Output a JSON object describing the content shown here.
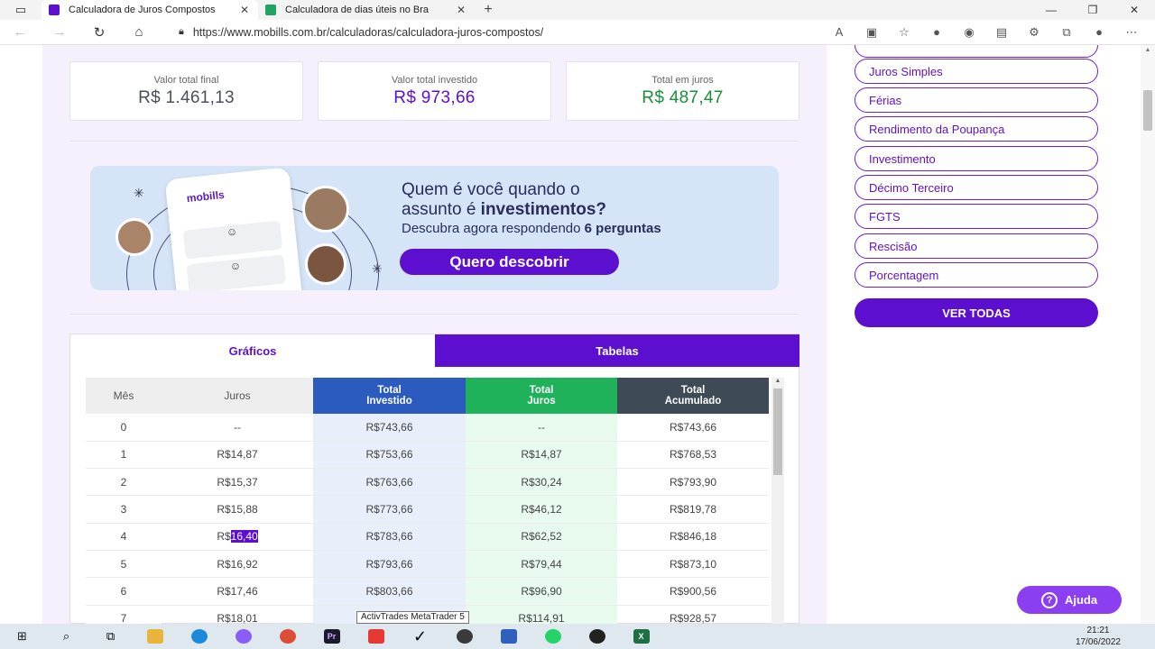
{
  "browser": {
    "tabs": [
      {
        "title": "Calculadora de Juros Compostos",
        "favicon_color": "#5d0fcf",
        "active": true
      },
      {
        "title": "Calculadora de dias úteis no Bra",
        "favicon_color": "#1fa463",
        "active": false
      }
    ],
    "url": "https://www.mobills.com.br/calculadoras/calculadora-juros-compostos/"
  },
  "summary": [
    {
      "label": "Valor total final",
      "value": "R$ 1.461,13",
      "color": "#4a4f5a"
    },
    {
      "label": "Valor total investido",
      "value": "R$ 973,66",
      "color": "#5d0fcf"
    },
    {
      "label": "Total em juros",
      "value": "R$ 487,47",
      "color": "#1a8f3a"
    }
  ],
  "banner": {
    "brand": "mobills",
    "headline_1": "Quem é você quando o",
    "headline_2a": "assunto é ",
    "headline_2b": "investimentos?",
    "sub_a": "Descubra agora respondendo ",
    "sub_b": "6 perguntas",
    "cta": "Quero descobrir"
  },
  "result_tabs": {
    "graphs": "Gráficos",
    "tables": "Tabelas"
  },
  "table": {
    "headers": {
      "mes": "Mês",
      "juros": "Juros",
      "invested_1": "Total",
      "invested_2": "Investido",
      "interest_1": "Total",
      "interest_2": "Juros",
      "accum_1": "Total",
      "accum_2": "Acumulado"
    },
    "rows": [
      {
        "mes": "0",
        "juros": "--",
        "investido": "R$743,66",
        "total_juros": "--",
        "acumulado": "R$743,66"
      },
      {
        "mes": "1",
        "juros": "R$14,87",
        "investido": "R$753,66",
        "total_juros": "R$14,87",
        "acumulado": "R$768,53"
      },
      {
        "mes": "2",
        "juros": "R$15,37",
        "investido": "R$763,66",
        "total_juros": "R$30,24",
        "acumulado": "R$793,90"
      },
      {
        "mes": "3",
        "juros": "R$15,88",
        "investido": "R$773,66",
        "total_juros": "R$46,12",
        "acumulado": "R$819,78"
      },
      {
        "mes": "4",
        "juros_prefix": "R$",
        "juros_selected": "16,40",
        "investido": "R$783,66",
        "total_juros": "R$62,52",
        "acumulado": "R$846,18"
      },
      {
        "mes": "5",
        "juros": "R$16,92",
        "investido": "R$793,66",
        "total_juros": "R$79,44",
        "acumulado": "R$873,10"
      },
      {
        "mes": "6",
        "juros": "R$17,46",
        "investido": "R$803,66",
        "total_juros": "R$96,90",
        "acumulado": "R$900,56"
      },
      {
        "mes": "7",
        "juros": "R$18,01",
        "investido": "",
        "total_juros": "R$114,91",
        "acumulado": "R$928,57"
      }
    ]
  },
  "sidebar": {
    "links": [
      "Juros Simples",
      "Férias",
      "Rendimento da Poupança",
      "Investimento",
      "Décimo Terceiro",
      "FGTS",
      "Rescisão",
      "Porcentagem"
    ],
    "see_all": "VER TODAS"
  },
  "help": "Ajuda",
  "tooltip": "ActivTrades MetaTrader 5",
  "clock": {
    "time": "21:21",
    "date": "17/06/2022"
  }
}
